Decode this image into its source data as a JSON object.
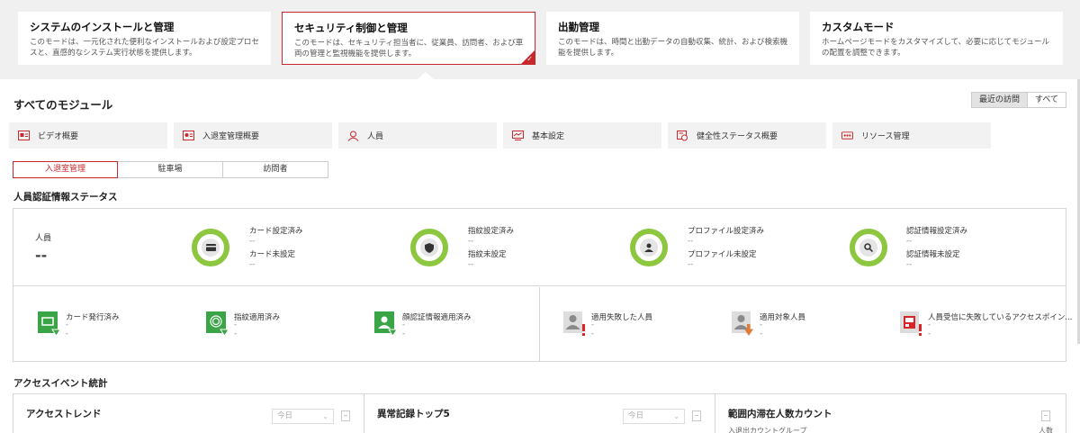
{
  "modes": [
    {
      "title": "システムのインストールと管理",
      "desc": "このモードは、一元化された便利なインストールおよび設定プロセスと、直感的なシステム実行状態を提供します。",
      "active": false
    },
    {
      "title": "セキュリティ制御と管理",
      "desc": "このモードは、セキュリティ担当者に、従業員、訪問者、および車両の管理と監視機能を提供します。",
      "active": true
    },
    {
      "title": "出勤管理",
      "desc": "このモードは、時間と出勤データの自動収集、統計、および検索機能を提供します。",
      "active": false
    },
    {
      "title": "カスタムモード",
      "desc": "ホームページモードをカスタマイズして、必要に応じてモジュールの配置を調整できます。",
      "active": false
    }
  ],
  "modules_section": {
    "title": "すべてのモジュール",
    "toggle": [
      "最近の訪問",
      "すべて"
    ],
    "items": [
      {
        "label": "ビデオ概要",
        "icon": "video-icon"
      },
      {
        "label": "入退室管理概要",
        "icon": "access-control-icon"
      },
      {
        "label": "人員",
        "icon": "person-icon"
      },
      {
        "label": "基本設定",
        "icon": "settings-icon"
      },
      {
        "label": "健全性ステータス概要",
        "icon": "health-status-icon"
      },
      {
        "label": "リソース管理",
        "icon": "resource-icon"
      }
    ]
  },
  "tabs": [
    "入退室管理",
    "駐車場",
    "訪問者"
  ],
  "credential_status": {
    "title": "人員認証情報ステータス",
    "persons_label": "人員",
    "persons_value": "--",
    "stats": [
      {
        "icon": "card-icon",
        "l1": "カード設定済み",
        "v1": "--",
        "l2": "カード未設定",
        "v2": "--"
      },
      {
        "icon": "fingerprint-icon",
        "l1": "指紋設定済み",
        "v1": "--",
        "l2": "指紋未設定",
        "v2": "--"
      },
      {
        "icon": "profile-icon",
        "l1": "プロファイル設定済み",
        "v1": "--",
        "l2": "プロファイル未設定",
        "v2": "--"
      },
      {
        "icon": "credential-search-icon",
        "l1": "認証情報設定済み",
        "v1": "--",
        "l2": "認証情報未設定",
        "v2": "--"
      }
    ],
    "indicators": [
      {
        "label": "カード発行済み",
        "value": "--",
        "icon": "card-issued-icon"
      },
      {
        "label": "指紋適用済み",
        "value": "--",
        "icon": "fingerprint-applied-icon"
      },
      {
        "label": "顔認証情報適用済み",
        "value": "--",
        "icon": "face-applied-icon"
      },
      {
        "label": "適用失敗した人員",
        "value": "--",
        "icon": "failed-person-icon"
      },
      {
        "label": "適用対象人員",
        "value": "--",
        "icon": "target-person-icon"
      },
      {
        "label": "人員受信に失敗しているアクセスポイン...",
        "value": "--",
        "icon": "access-point-failed-icon"
      }
    ]
  },
  "access_stats": {
    "title": "アクセスイベント統計",
    "panels": [
      {
        "title": "アクセストレンド",
        "select": "今日"
      },
      {
        "title": "異常記録トップ5",
        "select": "今日"
      },
      {
        "title": "範囲内滞在人数カウント",
        "sub_left": "入退出カウントグループ",
        "sub_right": "人数"
      }
    ]
  },
  "colors": {
    "accent": "#c8282b",
    "ring": "#8dc63f",
    "success": "#3aa546",
    "warning": "#e07b39"
  }
}
